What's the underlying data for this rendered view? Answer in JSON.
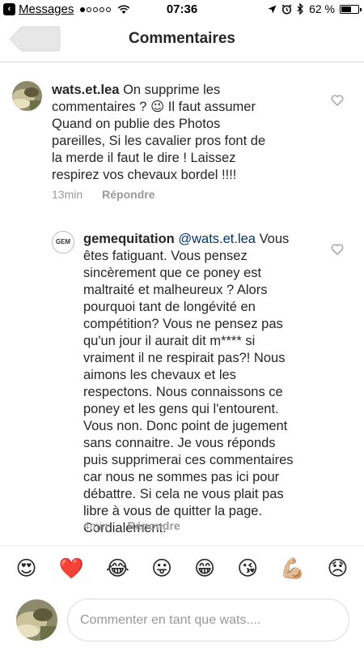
{
  "status_bar": {
    "back_app": "Messages",
    "time": "07:36",
    "battery": "62 %",
    "battery_level": 0.62,
    "signal_dots": [
      true,
      false,
      false,
      false,
      false
    ]
  },
  "nav": {
    "title": "Commentaires",
    "back_icon": "back-arrow-icon"
  },
  "comments": [
    {
      "username": "wats.et.lea",
      "text": "On supprime les commentaires ? 😉 Il faut assumer Quand on publie des Photos pareilles, Si les cavalier pros font de la merde il faut le dire ! Laissez respirez vos chevaux bordel !!!!",
      "time": "13min",
      "reply_label": "Répondre"
    },
    {
      "username": "gemequitation",
      "mention": "@wats.et.lea",
      "text": "Vous êtes fatiguant. Vous pensez sincèrement que ce poney est maltraité et malheureux ? Alors pourquoi tant de longévité en compétition? Vous ne pensez pas qu'un jour il aurait dit m**** si vraiment il ne respirait pas?! Nous aimons les chevaux et les respectons. Nous connaissons ce poney et les gens qui l'entourent. Vous non. Donc point de jugement sans connaitre. Je vous réponds puis supprimerai ces commentaires car nous ne sommes pas ici pour débattre. Si cela ne vous plait pas libre à vous de quitter la page. Cordialement.",
      "time": "4min",
      "reply_label": "Répondre",
      "avatar_text": "GEM"
    }
  ],
  "emoji_bar": [
    "😍",
    "❤️",
    "😂",
    "😛",
    "😁",
    "😘",
    "💪🏼",
    "😞"
  ],
  "composer": {
    "placeholder": "Commenter en tant que wats...."
  }
}
